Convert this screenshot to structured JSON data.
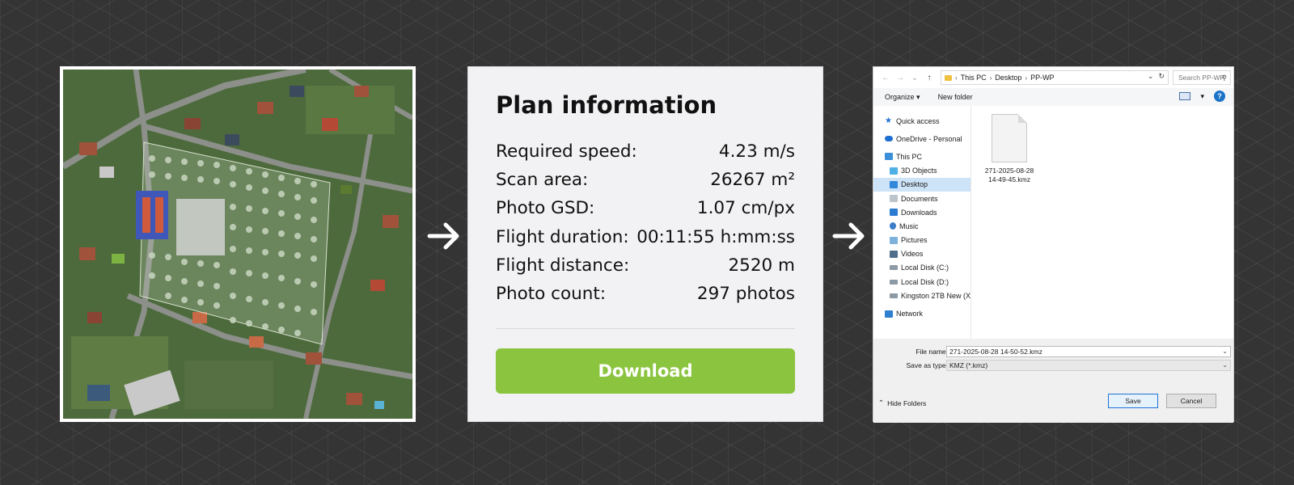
{
  "plan": {
    "title": "Plan information",
    "rows": [
      {
        "label": "Required speed:",
        "value": "4.23 m/s"
      },
      {
        "label": "Scan area:",
        "value": "26267 m²"
      },
      {
        "label": "Photo GSD:",
        "value": "1.07 cm/px"
      },
      {
        "label": "Flight duration:",
        "value": "00:11:55 h:mm:ss"
      },
      {
        "label": "Flight distance:",
        "value": "2520 m"
      },
      {
        "label": "Photo count:",
        "value": "297 photos"
      }
    ],
    "download_label": "Download",
    "download_color": "#8bc43f"
  },
  "map": {
    "icon": "aerial-survey-map",
    "waypoint_color": "#c8d6bf",
    "marker_color": "#7cb342"
  },
  "arrows": {
    "icon": "arrow-right-icon"
  },
  "dialog": {
    "breadcrumb": [
      "This PC",
      "Desktop",
      "PP-WP"
    ],
    "search_placeholder": "Search PP-WP",
    "toolbar": {
      "organize": "Organize",
      "new_folder": "New folder"
    },
    "nav_items": [
      {
        "label": "Quick access",
        "icon": "star-icon"
      },
      {
        "label": "OneDrive - Personal",
        "icon": "cloud-icon"
      },
      {
        "label": "This PC",
        "icon": "computer-icon"
      },
      {
        "label": "3D Objects",
        "icon": "cube-icon"
      },
      {
        "label": "Desktop",
        "icon": "desktop-icon",
        "selected": true
      },
      {
        "label": "Documents",
        "icon": "document-icon"
      },
      {
        "label": "Downloads",
        "icon": "download-icon"
      },
      {
        "label": "Music",
        "icon": "music-icon"
      },
      {
        "label": "Pictures",
        "icon": "pictures-icon"
      },
      {
        "label": "Videos",
        "icon": "video-icon"
      },
      {
        "label": "Local Disk (C:)",
        "icon": "disk-icon"
      },
      {
        "label": "Local Disk (D:)",
        "icon": "disk-icon"
      },
      {
        "label": "Kingston 2TB New (X:",
        "icon": "disk-icon"
      },
      {
        "label": "Network",
        "icon": "network-icon"
      }
    ],
    "file": {
      "name_line1": "271-2025-08-28",
      "name_line2": "14-49-45.kmz"
    },
    "file_name_label": "File name:",
    "file_name_value": "271-2025-08-28 14-50-52.kmz",
    "save_type_label": "Save as type:",
    "save_type_value": "KMZ (*.kmz)",
    "hide_folders": "Hide Folders",
    "save_label": "Save",
    "cancel_label": "Cancel"
  }
}
